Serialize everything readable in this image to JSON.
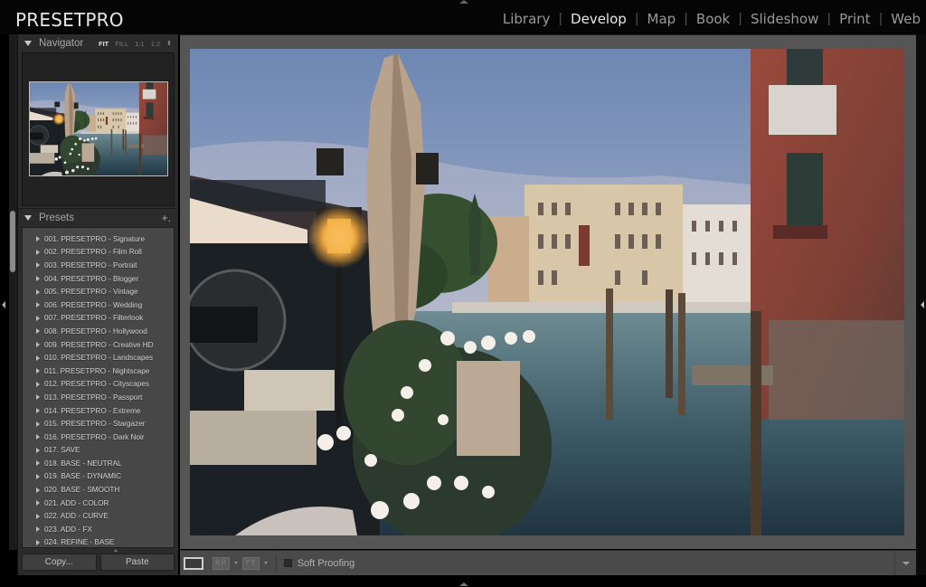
{
  "app": {
    "brand": "PRESETPRO"
  },
  "modules": [
    {
      "label": "Library",
      "active": false
    },
    {
      "label": "Develop",
      "active": true
    },
    {
      "label": "Map",
      "active": false
    },
    {
      "label": "Book",
      "active": false
    },
    {
      "label": "Slideshow",
      "active": false
    },
    {
      "label": "Print",
      "active": false
    },
    {
      "label": "Web",
      "active": false
    }
  ],
  "navigator": {
    "title": "Navigator",
    "zoom_options": [
      "FIT",
      "FILL",
      "1:1",
      "1:2"
    ],
    "active_zoom": "FIT"
  },
  "presets": {
    "title": "Presets",
    "add_label": "+.",
    "items": [
      "001. PRESETPRO - Signature",
      "002. PRESETPRO - Film Roll",
      "003. PRESETPRO - Portrait",
      "004. PRESETPRO - Blogger",
      "005. PRESETPRO - Vintage",
      "006. PRESETPRO - Wedding",
      "007. PRESETPRO - Filterlook",
      "008. PRESETPRO - Hollywood",
      "009. PRESETPRO - Creative HD",
      "010. PRESETPRO - Landscapes",
      "011. PRESETPRO - Nightscape",
      "012. PRESETPRO - Cityscapes",
      "013. PRESETPRO - Passport",
      "014. PRESETPRO - Extreme",
      "015. PRESETPRO - Stargazer",
      "016. PRESETPRO - Dark Noir",
      "017. SAVE",
      "018. BASE - NEUTRAL",
      "019. BASE - DYNAMIC",
      "020. BASE - SMOOTH",
      "021. ADD - COLOR",
      "022. ADD - CURVE",
      "023. ADD - FX",
      "024. REFINE - BASE"
    ]
  },
  "buttons": {
    "copy": "Copy...",
    "paste": "Paste"
  },
  "toolbar": {
    "before_after_lr": "RR",
    "before_after_tb": "YY",
    "soft_proofing_label": "Soft Proofing",
    "soft_proofing_checked": false
  },
  "photo": {
    "subject": "Venice Grand Canal with umbrella, street lamps and flowers"
  }
}
